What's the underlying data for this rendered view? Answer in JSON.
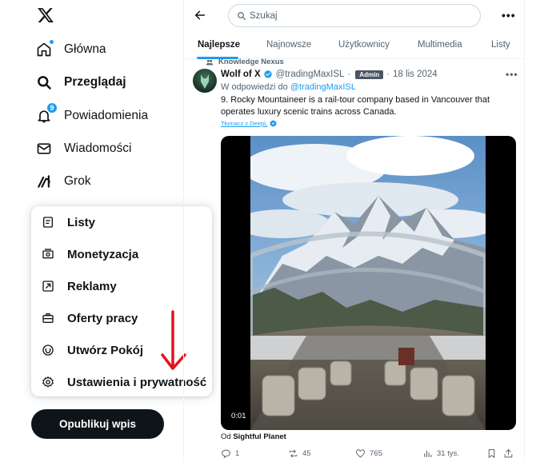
{
  "sidebar": {
    "logo": "x-logo-icon",
    "nav": [
      {
        "label": "Główna",
        "icon": "home-icon",
        "active": false
      },
      {
        "label": "Przeglądaj",
        "icon": "search-icon",
        "active": true
      },
      {
        "label": "Powiadomienia",
        "icon": "bell-icon",
        "badge": "9"
      },
      {
        "label": "Wiadomości",
        "icon": "mail-icon"
      },
      {
        "label": "Grok",
        "icon": "grok-icon"
      }
    ],
    "more_menu": [
      {
        "label": "Listy",
        "icon": "list-icon"
      },
      {
        "label": "Monetyzacja",
        "icon": "money-icon"
      },
      {
        "label": "Reklamy",
        "icon": "ads-icon"
      },
      {
        "label": "Oferty pracy",
        "icon": "briefcase-icon"
      },
      {
        "label": "Utwórz Pokój",
        "icon": "spaces-icon"
      },
      {
        "label": "Ustawienia i prywatność",
        "icon": "gear-icon"
      }
    ],
    "post_button": "Opublikuj wpis"
  },
  "topbar": {
    "search_placeholder": "Szukaj"
  },
  "tabs": [
    "Najlepsze",
    "Najnowsze",
    "Użytkownicy",
    "Multimedia",
    "Listy"
  ],
  "tweet": {
    "context": "Knowledge Nexus",
    "name": "Wolf of X",
    "handle": "@tradingMaxISL",
    "badge": "Admin",
    "date": "18 lis 2024",
    "reply_prefix": "W odpowiedzi do",
    "reply_to": "@tradingMaxISL",
    "text": "9. Rocky Mountaineer is a rail-tour company based in Vancouver that operates luxury scenic trains across Canada.",
    "translate": "Tłumacz z DeepL",
    "video_time": "0:01",
    "source_prefix": "Od",
    "source_name": "Sightful Planet",
    "replies": "1",
    "reposts": "45",
    "likes": "765",
    "views": "31 tys."
  },
  "colors": {
    "accent": "#1d9bf0",
    "text": "#0f1419",
    "muted": "#536471",
    "arrow": "#e0141e"
  }
}
